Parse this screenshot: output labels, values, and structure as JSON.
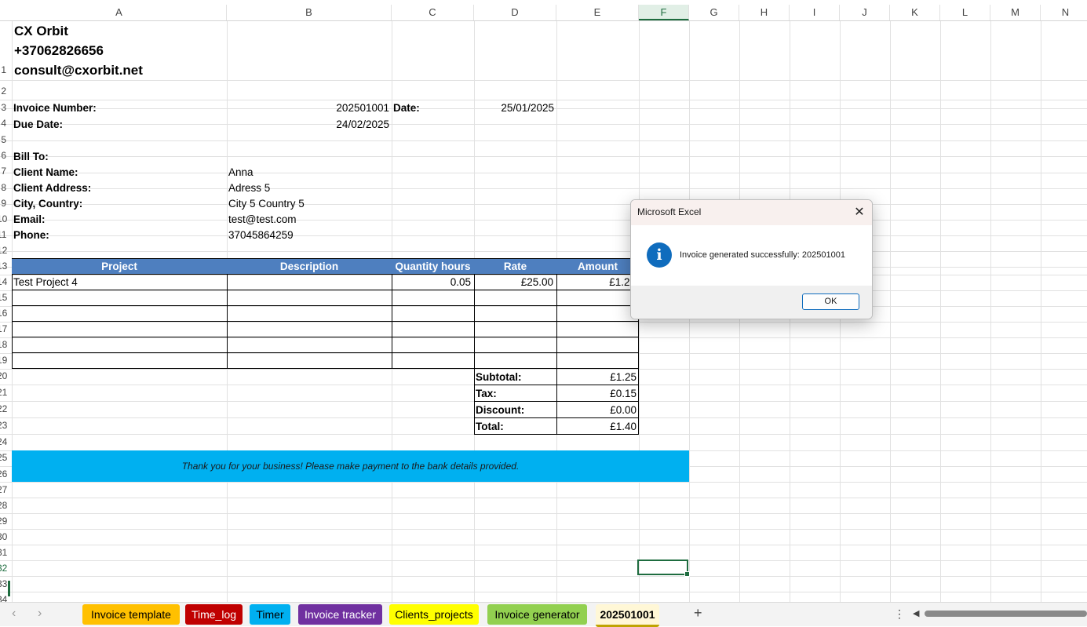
{
  "columns": [
    "A",
    "B",
    "C",
    "D",
    "E",
    "F",
    "G",
    "H",
    "I",
    "J",
    "K",
    "L",
    "M",
    "N"
  ],
  "selected_column": "F",
  "row_numbers": [
    "1",
    "2",
    "3",
    "4",
    "5",
    "6",
    "7",
    "8",
    "9",
    "10",
    "11",
    "12",
    "13",
    "14",
    "15",
    "16",
    "17",
    "18",
    "19",
    "20",
    "21",
    "22",
    "23",
    "24",
    "25",
    "26",
    "27",
    "28",
    "29",
    "30",
    "31",
    "32",
    "33",
    "34"
  ],
  "selected_row": "32",
  "company": {
    "name": "CX Orbit",
    "phone": "+37062826656",
    "email": "consult@cxorbit.net"
  },
  "invoice": {
    "number_label": "Invoice Number:",
    "number_value": "202501001",
    "date_label": "Date:",
    "date_value": "25/01/2025",
    "due_label": "Due Date:",
    "due_value": "24/02/2025"
  },
  "bill_to": {
    "heading": "Bill To:",
    "fields": [
      {
        "label": "Client Name:",
        "value": "Anna"
      },
      {
        "label": "Client Address:",
        "value": "Adress 5"
      },
      {
        "label": "City, Country:",
        "value": "City 5 Country 5"
      },
      {
        "label": "Email:",
        "value": "test@test.com"
      },
      {
        "label": "Phone:",
        "value": "37045864259"
      }
    ]
  },
  "table": {
    "headers": [
      "Project",
      "Description",
      "Quantity hours",
      "Rate",
      "Amount"
    ],
    "rows": [
      {
        "project": "Test Project 4",
        "description": "",
        "quantity": "0.05",
        "rate": "£25.00",
        "amount": "£1.25"
      }
    ]
  },
  "totals": [
    {
      "label": "Subtotal:",
      "value": "£1.25"
    },
    {
      "label": "Tax:",
      "value": "£0.15"
    },
    {
      "label": "Discount:",
      "value": "£0.00"
    },
    {
      "label": "Total:",
      "value": "£1.40"
    }
  ],
  "thank_you": "Thank you for your business! Please make payment to the bank details provided.",
  "dialog": {
    "title": "Microsoft Excel",
    "message": "Invoice generated successfully: 202501001",
    "ok_label": "OK",
    "icon": "info-icon"
  },
  "tabs": [
    {
      "label": "Invoice template",
      "color": "#ffc000",
      "text_color": "#000000"
    },
    {
      "label": "Time_log",
      "color": "#c00000",
      "text_color": "#ffffff"
    },
    {
      "label": "Timer",
      "color": "#00b0f0",
      "text_color": "#000000"
    },
    {
      "label": "Invoice tracker",
      "color": "#7030a0",
      "text_color": "#ffffff"
    },
    {
      "label": "Clients_projects",
      "color": "#ffff00",
      "text_color": "#000000"
    },
    {
      "label": "Invoice generator",
      "color": "#92d050",
      "text_color": "#000000"
    },
    {
      "label": "202501001",
      "color": "#ffffff",
      "text_color": "#000000",
      "active": true
    }
  ],
  "colors": {
    "header_blue": "#4e7fbf",
    "thanks_band": "#00b0f0",
    "excel_green": "#1e6c3f"
  }
}
